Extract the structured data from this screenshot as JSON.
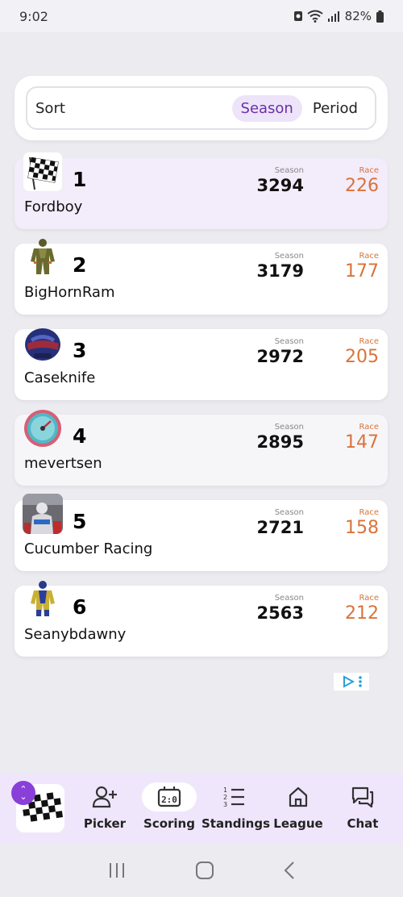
{
  "status": {
    "time": "9:02",
    "battery": "82%"
  },
  "sort": {
    "label": "Sort",
    "options": [
      {
        "label": "Season",
        "active": true
      },
      {
        "label": "Period",
        "active": false
      }
    ]
  },
  "columns": {
    "season": "Season",
    "race": "Race"
  },
  "standings": [
    {
      "rank": "1",
      "name": "Fordboy",
      "season": "3294",
      "race": "226",
      "avatar": "checkered-flag-icon"
    },
    {
      "rank": "2",
      "name": "BigHornRam",
      "season": "3179",
      "race": "177",
      "avatar": "racing-suit-green-icon"
    },
    {
      "rank": "3",
      "name": "Caseknife",
      "season": "2972",
      "race": "205",
      "avatar": "racing-helmet-icon"
    },
    {
      "rank": "4",
      "name": "mevertsen",
      "season": "2895",
      "race": "147",
      "avatar": "gauge-icon"
    },
    {
      "rank": "5",
      "name": "Cucumber Racing",
      "season": "2721",
      "race": "158",
      "avatar": "driver-photo"
    },
    {
      "rank": "6",
      "name": "Seanybdawny",
      "season": "2563",
      "race": "212",
      "avatar": "racing-suit-yellow-icon"
    }
  ],
  "nav": {
    "items": [
      {
        "label": "Picker",
        "icon": "add-user-icon"
      },
      {
        "label": "Scoring",
        "icon": "scoreboard-icon",
        "active": true
      },
      {
        "label": "Standings",
        "icon": "ranked-list-icon"
      },
      {
        "label": "League",
        "icon": "home-icon"
      },
      {
        "label": "Chat",
        "icon": "chat-icon"
      }
    ]
  },
  "colors": {
    "accent": "#8a3fd8",
    "race": "#d9733a",
    "highlight": "#f3ecfb"
  }
}
